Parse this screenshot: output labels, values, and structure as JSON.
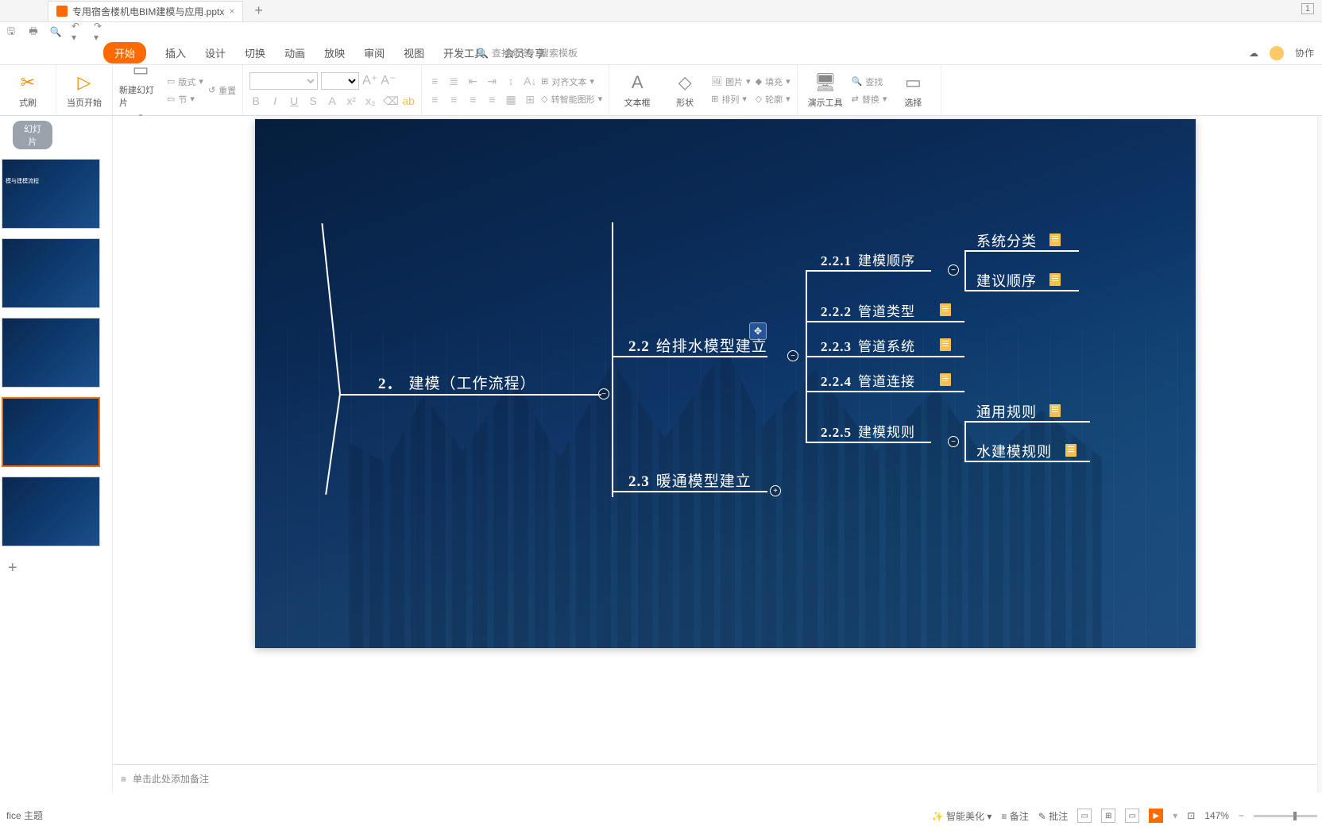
{
  "tab": {
    "title": "专用宿舍楼机电BIM建模与应用.pptx",
    "close": "×"
  },
  "window_indicator": "1",
  "ribbon_tabs": {
    "active": "开始",
    "items": [
      "插入",
      "设计",
      "切换",
      "动画",
      "放映",
      "审阅",
      "视图",
      "开发工具",
      "会员专享"
    ]
  },
  "search_placeholder": "查找命令、搜索模板",
  "topright": {
    "cloud": "",
    "collab": "协作"
  },
  "ribbon": {
    "format_painter": "式刷",
    "from_current": "当页开始",
    "new_slide": "新建幻灯片",
    "layout": "版式",
    "section": "节",
    "reset": "重置",
    "align_text": "对齐文本",
    "smart_art": "转智能图形",
    "textbox": "文本框",
    "shape": "形状",
    "picture": "图片",
    "fill": "填充",
    "arrange": "排列",
    "outline": "轮廓",
    "demo_tools": "演示工具",
    "find": "查找",
    "replace": "替换",
    "select": "选择"
  },
  "slides_tab": "幻灯片",
  "thumbs": {
    "t1": "模与建模流程"
  },
  "mindmap": {
    "root_num": "2．",
    "root": "建模（工作流程）",
    "n22_num": "2.2",
    "n22": "给排水模型建立",
    "n23_num": "2.3",
    "n23": "暖通模型建立",
    "n221_num": "2.2.1",
    "n221": "建模顺序",
    "n222_num": "2.2.2",
    "n222": "管道类型",
    "n223_num": "2.2.3",
    "n223": "管道系统",
    "n224_num": "2.2.4",
    "n224": "管道连接",
    "n225_num": "2.2.5",
    "n225": "建模规则",
    "leaf_sys": "系统分类",
    "leaf_order": "建议顺序",
    "leaf_gen": "通用规则",
    "leaf_water": "水建模规则"
  },
  "notes_placeholder": "单击此处添加备注",
  "status": {
    "theme": "fice 主题",
    "beautify": "智能美化",
    "notes_btn": "备注",
    "comments": "批注",
    "zoom": "147%"
  }
}
